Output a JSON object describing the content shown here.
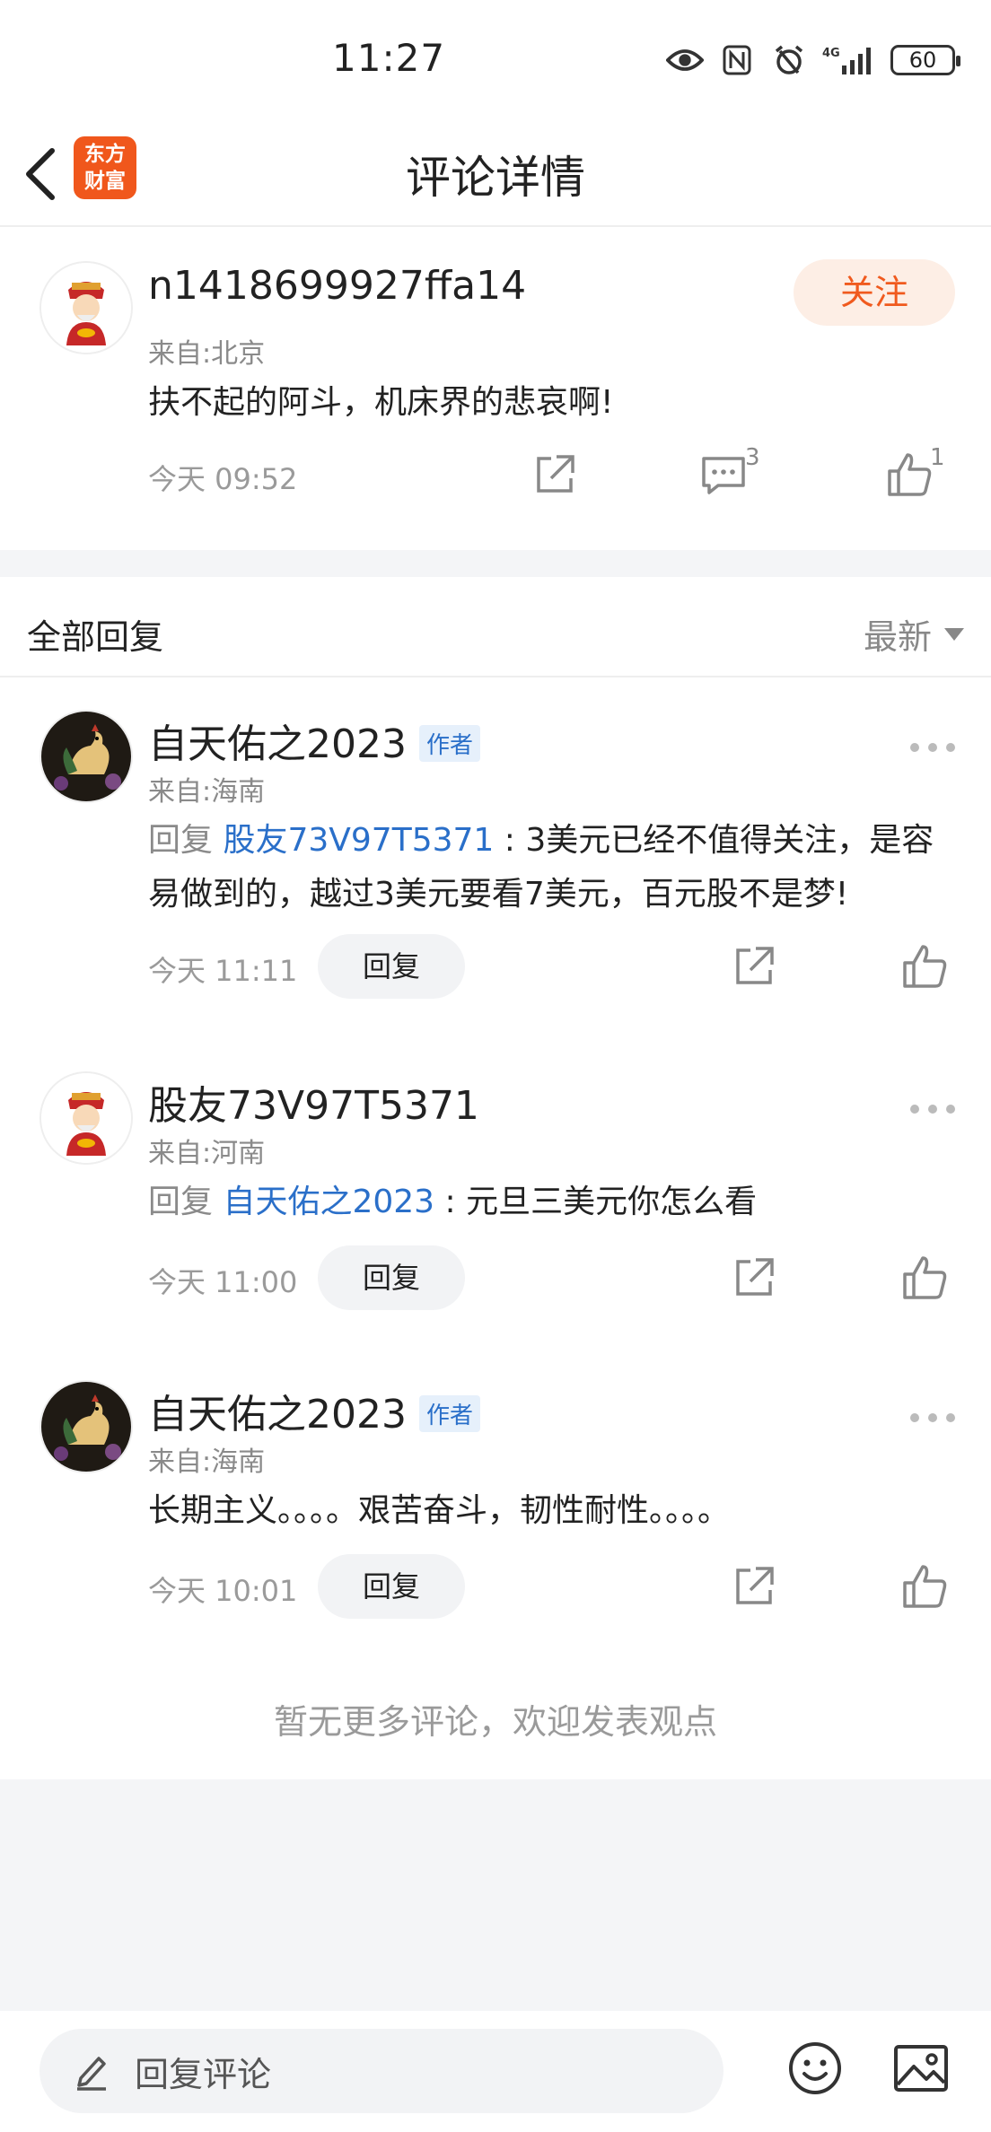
{
  "status_bar": {
    "time": "11:27",
    "battery": "60",
    "icons": [
      "eye-icon",
      "nfc-icon",
      "alarm-icon",
      "signal-4g-icon"
    ],
    "network_label": "4G"
  },
  "header": {
    "title": "评论详情",
    "logo_line1": "东方",
    "logo_line2": "财富"
  },
  "main_comment": {
    "username": "n1418699927ffa14",
    "location": "来自:北京",
    "content": "扶不起的阿斗，机床界的悲哀啊!",
    "time": "今天 09:52",
    "follow_label": "关注",
    "comment_count": "3",
    "like_count": "1"
  },
  "replies_section": {
    "title": "全部回复",
    "sort_label": "最新"
  },
  "replies": [
    {
      "username": "自天佑之2023",
      "author_tag": "作者",
      "location": "来自:海南",
      "reply_prefix": "回复 ",
      "mention": "股友73V97T5371",
      "content_line1": " : 3美元已经不值得关注，是容",
      "content_line2": "易做到的，越过3美元要看7美元，百元股不是梦!",
      "time": "今天 11:11",
      "reply_label": "回复"
    },
    {
      "username": "股友73V97T5371",
      "location": "来自:河南",
      "reply_prefix": "回复 ",
      "mention": "自天佑之2023",
      "content_line1": " : 元旦三美元你怎么看",
      "time": "今天 11:00",
      "reply_label": "回复"
    },
    {
      "username": "自天佑之2023",
      "author_tag": "作者",
      "location": "来自:海南",
      "content_line1": "长期主义。。。。艰苦奋斗，韧性耐性。。。。",
      "time": "今天 10:01",
      "reply_label": "回复"
    }
  ],
  "footer": {
    "no_more": "暂无更多评论，欢迎发表观点",
    "input_placeholder": "回复评论"
  },
  "colors": {
    "brand": "#f0571c",
    "link": "#2a6fc9",
    "follow_bg": "#fdeee5"
  }
}
